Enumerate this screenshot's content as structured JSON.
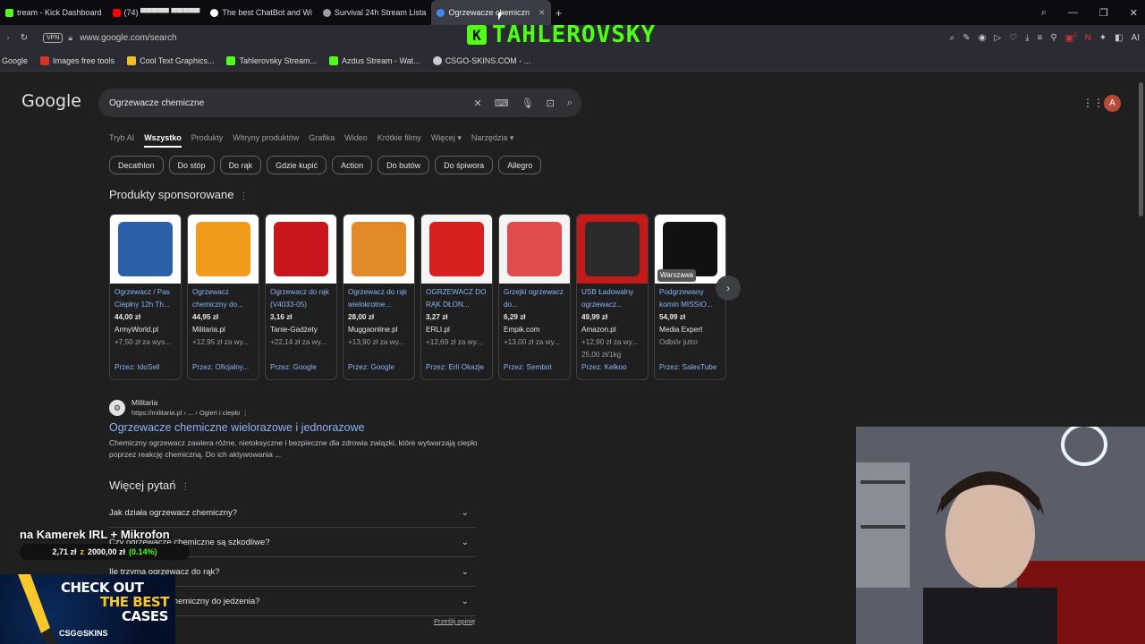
{
  "browser": {
    "tabs": [
      {
        "label": "tream - Kick Dashboard",
        "color": "#53fc18"
      },
      {
        "label": "(74) ▀▀▀▀▀ ▀▀▀▀▀",
        "color": "#ff0000"
      },
      {
        "label": "The best ChatBot and Wi",
        "color": "#ffffff"
      },
      {
        "label": "Survival 24h Stream Lista",
        "color": "#9aa0a6"
      },
      {
        "label": "Ogrzewacze chemiczn",
        "color": "#4285f4"
      }
    ],
    "new_tab": "+",
    "url": "www.google.com/search",
    "vpn_label": "VPN",
    "ai_label": "AI",
    "badge_count": "2",
    "bookmarks": [
      {
        "label": "Google",
        "color": "#4285f4"
      },
      {
        "label": "Images free tools",
        "color": "#d93025"
      },
      {
        "label": "Cool Text Graphics...",
        "color": "#f0c020"
      },
      {
        "label": "Tahlerovsky Stream...",
        "color": "#53fc18"
      },
      {
        "label": "Azdus Stream - Wat...",
        "color": "#53fc18"
      },
      {
        "label": "CSGO-SKINS.COM - ...",
        "color": "#cccccc"
      }
    ]
  },
  "overlay": {
    "streamer_name": "TAHLEROVSKY",
    "kick_letter": "K",
    "goal_title": "na Kamerek IRL + Mikrofon",
    "goal_amount": "2,71 zł",
    "goal_sep": "z",
    "goal_target": "2000,00 zł",
    "goal_percent": "(0.14%)",
    "promo_line1": "CHECK OUT",
    "promo_line2": "THE BEST",
    "promo_line3": "CASES",
    "promo_brand": "CSG⊙SKINS"
  },
  "google": {
    "logo": "Google",
    "query": "Ogrzewacze chemiczne",
    "avatar_letter": "A",
    "tabs": [
      "Tryb AI",
      "Wszystko",
      "Produkty",
      "Witryny produktów",
      "Grafika",
      "Wideo",
      "Krótkie filmy",
      "Więcej ▾",
      "Narzędzia ▾"
    ],
    "chips": [
      "Decathlon",
      "Do stóp",
      "Do rąk",
      "Gdzie kupić",
      "Action",
      "Do butów",
      "Do śpiwora",
      "Allegro"
    ],
    "sponsored_title": "Produkty sponsorowane",
    "products": [
      {
        "title": "Ogrzewacz / Pas Ciepłny 12h Th...",
        "price": "44,00 zł",
        "store": "ArmyWorld.pl",
        "ship": "+7,50 zł za wys...",
        "extra": "",
        "by": "Przez: IdoSell",
        "img_color": "#2b5fa8",
        "img_color2": "#ffffff"
      },
      {
        "title": "Ogrzewacz chemiczny do...",
        "price": "44,95 zł",
        "store": "Militaria.pl",
        "ship": "+12,95 zł za wy...",
        "extra": "",
        "by": "Przez: Oficjalny...",
        "img_color": "#f29a1a",
        "img_color2": "#ffffff"
      },
      {
        "title": "Ogrzewacz do rąk (V4033-05)",
        "price": "3,16 zł",
        "store": "Tanie-Gadżety",
        "ship": "+22,14 zł za wy...",
        "extra": "",
        "by": "Przez: Google",
        "img_color": "#c9161c",
        "img_color2": "#ffffff"
      },
      {
        "title": "Ogrzewacz do rąk wielokrotne...",
        "price": "28,00 zł",
        "store": "Muggaonline.pl",
        "ship": "+13,90 zł za wy...",
        "extra": "",
        "by": "Przez: Google",
        "img_color": "#e28a2a",
        "img_color2": "#ffffff"
      },
      {
        "title": "OGRZEWACZ DO RĄK DŁON...",
        "price": "3,27 zł",
        "store": "ERLI.pl",
        "ship": "+12,69 zł za wy...",
        "extra": "",
        "by": "Przez: Erli Okazje",
        "img_color": "#d92020",
        "img_color2": "#f5f5f5"
      },
      {
        "title": "Grzejki ogrzewacz do...",
        "price": "6,29 zł",
        "store": "Empik.com",
        "ship": "+13,00 zł za wy...",
        "extra": "",
        "by": "Przez: Sembot",
        "img_color": "#e24b4b",
        "img_color2": "#f4f4f4"
      },
      {
        "title": "USB Ładowalny ogrzewacz...",
        "price": "49,99 zł",
        "store": "Amazon.pl",
        "ship": "+12,90 zł za wy...",
        "extra": "25,00 zł/1kg",
        "by": "Przez: Kelkoo",
        "img_color": "#2b2b2b",
        "img_color2": "#c31a1a"
      },
      {
        "title": "Podgrzewany komin MISSIO...",
        "price": "54,99 zł",
        "store": "Media Expert",
        "ship": "Odbiór jutro",
        "extra": "",
        "by": "Przez: SalesTube",
        "img_color": "#111111",
        "img_color2": "#ffffff",
        "location": "Warszawa"
      }
    ],
    "next_arrow": "›",
    "result": {
      "site_name": "Militaria",
      "site_url": "https://militaria.pl › ... › Ogień i ciepło",
      "title": "Ogrzewacze chemiczne wielorazowe i jednorazowe",
      "desc": "Chemiczny ogrzewacz zawiera różne, nietoksyczne i bezpieczne dla zdrowia związki, które wytwarzają ciepło poprzez reakcję chemiczną. Do ich aktywowania ..."
    },
    "paa_title": "Więcej pytań",
    "questions": [
      "Jak działa ogrzewacz chemiczny?",
      "Czy ogrzewacze chemiczne są szkodliwe?",
      "Ile trzyma ogrzewacz do rąk?",
      "Czy ogrzewacz chemiczny do jedzenia?"
    ],
    "feedback": "Prześlij opinię"
  }
}
